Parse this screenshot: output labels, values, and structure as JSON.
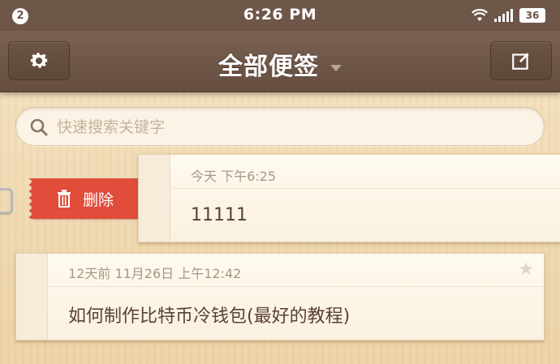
{
  "status_bar": {
    "notification_count": "2",
    "time": "6:26 PM",
    "battery": "36"
  },
  "nav": {
    "title": "全部便签"
  },
  "search": {
    "placeholder": "快速搜索关键字",
    "value": ""
  },
  "notes": [
    {
      "date": "今天 下午6:25",
      "text": "11111",
      "delete_label": "删除"
    },
    {
      "date": "12天前 11月26日 上午12:42",
      "text": "如何制作比特币冷钱包(最好的教程)"
    }
  ],
  "colors": {
    "delete": "#e14c3b",
    "nav": "#6e5648"
  }
}
